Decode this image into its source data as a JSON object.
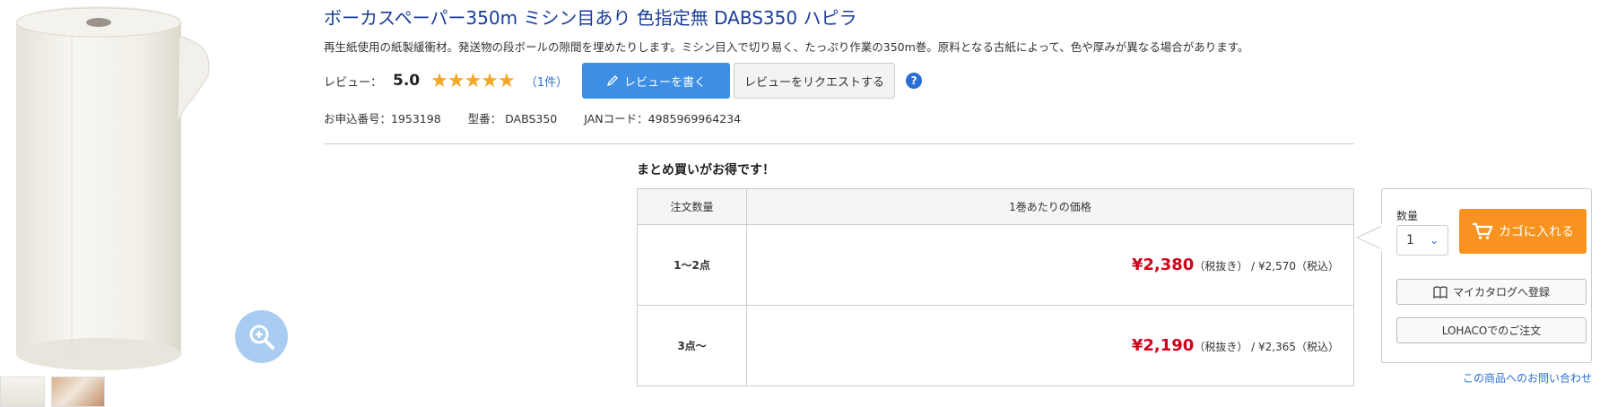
{
  "product": {
    "title": "ボーカスペーパー350m ミシン目あり 色指定無 DABS350 ハピラ",
    "description": "再生紙使用の紙製緩衝材。発送物の段ボールの隙間を埋めたりします。ミシン目入で切り易く、たっぷり作業の350m巻。原料となる古紙によって、色や厚みが異なる場合があります。"
  },
  "review": {
    "label": "レビュー：",
    "score": "5.0",
    "stars": "★★★★★",
    "count": "（1件）",
    "write_button": "レビューを書く",
    "request_button": "レビューをリクエストする",
    "help": "?"
  },
  "meta": {
    "order_number": "お申込番号：1953198",
    "model_number": "型番： DABS350",
    "jan_code": "JANコード：4985969964234"
  },
  "bulk": {
    "title": "まとめ買いがお得です！",
    "headers": [
      "注文数量",
      "1巻あたりの価格"
    ],
    "rows": [
      {
        "qty": "1～2点",
        "price": "¥2,380",
        "excl": "（税抜き）",
        "incl": " / ¥2,570（税込）"
      },
      {
        "qty": "3点～",
        "price": "¥2,190",
        "excl": "（税抜き）",
        "incl": " / ¥2,365（税込）"
      }
    ]
  },
  "cart": {
    "qty_label": "数量",
    "qty_value": "1",
    "add_button": "カゴに入れる",
    "catalog_button": "マイカタログへ登録",
    "lohaco_button": "LOHACOでのご注文",
    "inquiry_link": "この商品へのお問い合わせ"
  },
  "colors": {
    "title": "#1a3d9a",
    "price": "#d0021b",
    "accent_blue": "#3d8fe6",
    "cart_orange": "#f7931e",
    "star": "#f5a623"
  },
  "icons": [
    "zoom-icon",
    "pencil-icon",
    "help-icon",
    "chevron-down-icon",
    "cart-icon",
    "book-icon"
  ]
}
